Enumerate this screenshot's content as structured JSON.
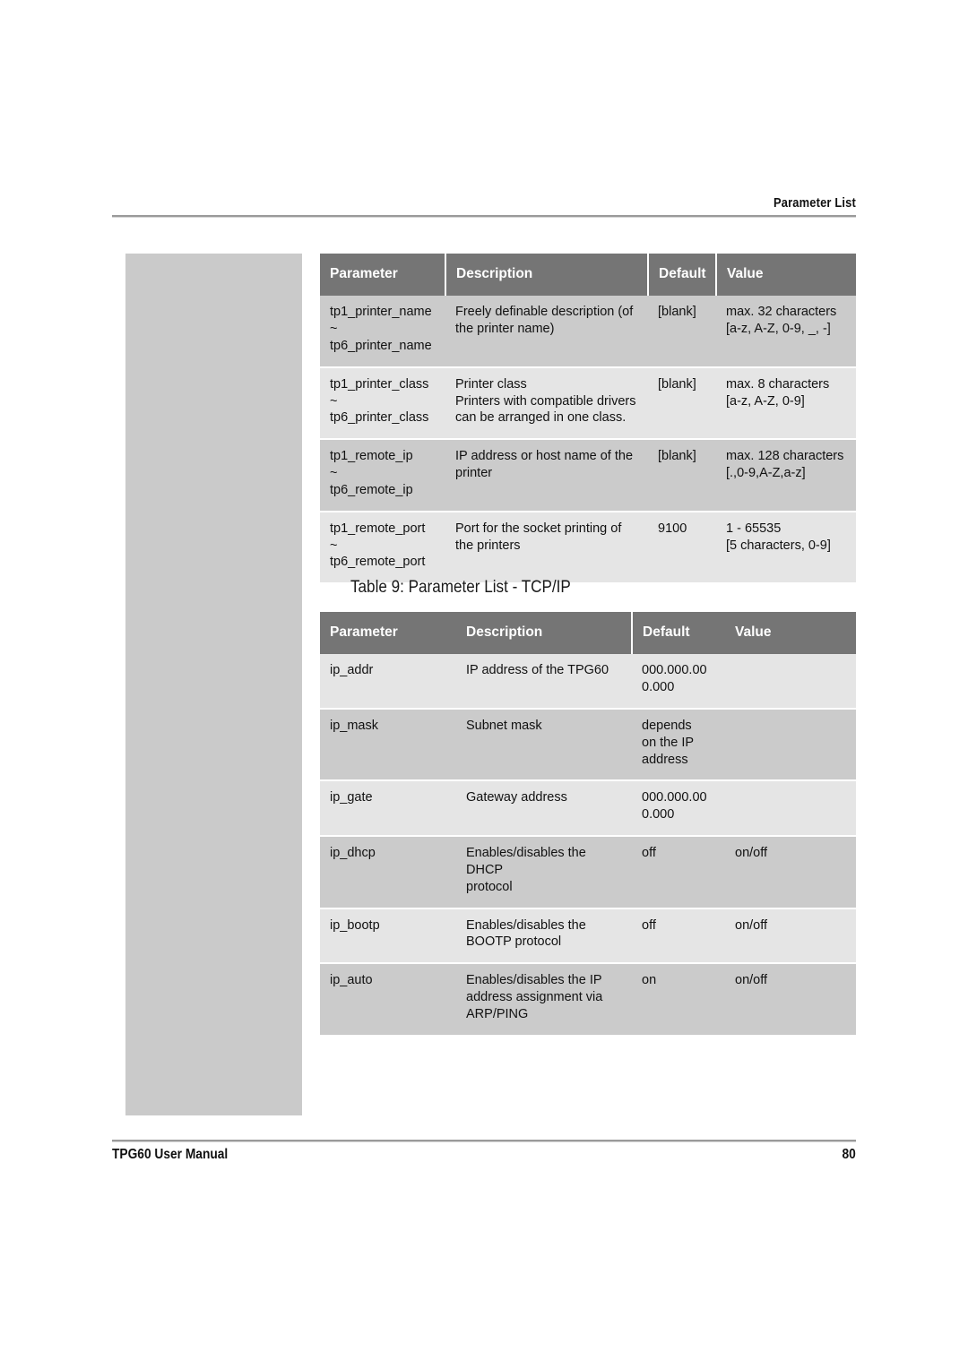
{
  "header": {
    "running_head": "Parameter List"
  },
  "footer": {
    "manual_title": "TPG60 User Manual",
    "page_number": "80"
  },
  "colors": {
    "table_header_bg": "#757575",
    "row_dark_bg": "#cbcbcb",
    "row_light_bg": "#e5e5e5",
    "side_block_bg": "#cacaca",
    "rule": "#9a9a9a"
  },
  "table_printer": {
    "columns": [
      "Parameter",
      "Description",
      "Default",
      "Value"
    ],
    "rows": [
      {
        "parameter": [
          "tp1_printer_name",
          "~",
          "tp6_printer_name"
        ],
        "description": [
          "Freely definable description (of",
          "the printer name)"
        ],
        "default": [
          "[blank]"
        ],
        "value": [
          "max. 32 characters",
          "[a-z, A-Z, 0-9, _, -]"
        ],
        "band": "dark"
      },
      {
        "parameter": [
          "tp1_printer_class",
          "~",
          "tp6_printer_class"
        ],
        "description": [
          "Printer class",
          "Printers with compatible drivers",
          "can be arranged in one class."
        ],
        "default": [
          "[blank]"
        ],
        "value": [
          "max. 8 characters",
          "[a-z, A-Z, 0-9]"
        ],
        "band": "light"
      },
      {
        "parameter": [
          "tp1_remote_ip",
          "~",
          "tp6_remote_ip"
        ],
        "description": [
          "IP address or host name of the",
          "printer"
        ],
        "default": [
          "[blank]"
        ],
        "value": [
          "max. 128 characters",
          "[.,0-9,A-Z,a-z]"
        ],
        "band": "dark"
      },
      {
        "parameter": [
          "tp1_remote_port",
          "~",
          "tp6_remote_port"
        ],
        "description": [
          "Port for the socket printing of",
          "the printers"
        ],
        "default": [
          "9100"
        ],
        "value": [
          "1 - 65535",
          "[5 characters, 0-9]"
        ],
        "band": "light"
      }
    ]
  },
  "caption": "Table 9: Parameter List - TCP/IP",
  "table_tcpip": {
    "columns": [
      "Parameter",
      "Description",
      "Default",
      "Value"
    ],
    "rows": [
      {
        "parameter": [
          "ip_addr"
        ],
        "description": [
          "IP address of the TPG60"
        ],
        "default": [
          "000.000.00",
          "0.000"
        ],
        "value": [
          ""
        ],
        "band": "light"
      },
      {
        "parameter": [
          "ip_mask"
        ],
        "description": [
          "Subnet mask"
        ],
        "default": [
          "depends",
          "on the IP",
          "address"
        ],
        "value": [
          ""
        ],
        "band": "dark"
      },
      {
        "parameter": [
          "ip_gate"
        ],
        "description": [
          "Gateway address"
        ],
        "default": [
          "000.000.00",
          "0.000"
        ],
        "value": [
          ""
        ],
        "band": "light"
      },
      {
        "parameter": [
          "ip_dhcp"
        ],
        "description": [
          "Enables/disables the DHCP",
          "protocol"
        ],
        "default": [
          "off"
        ],
        "value": [
          "on/off"
        ],
        "band": "dark"
      },
      {
        "parameter": [
          "ip_bootp"
        ],
        "description": [
          "Enables/disables the",
          "BOOTP protocol"
        ],
        "default": [
          "off"
        ],
        "value": [
          "on/off"
        ],
        "band": "light"
      },
      {
        "parameter": [
          "ip_auto"
        ],
        "description": [
          "Enables/disables the IP",
          "address assignment via",
          "ARP/PING"
        ],
        "default": [
          "on"
        ],
        "value": [
          "on/off"
        ],
        "band": "dark"
      }
    ]
  }
}
